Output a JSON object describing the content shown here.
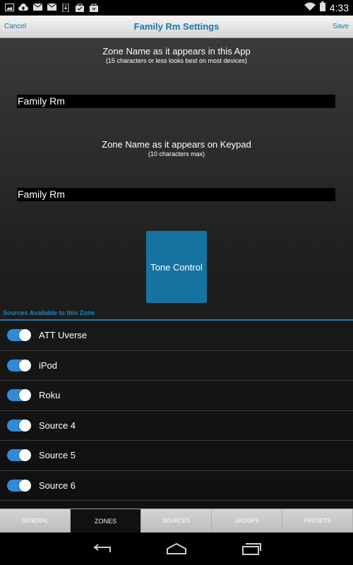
{
  "status_bar": {
    "time": "4:33",
    "left_icons": [
      "image-icon",
      "cloud-upload-icon",
      "mail-icon",
      "mail-icon",
      "download-icon",
      "shopping-bag-icon",
      "shopping-bag-icon"
    ]
  },
  "header": {
    "title": "Family Rm Settings",
    "cancel_label": "Cancel",
    "save_label": "Save"
  },
  "zone_app_name": {
    "caption": "Zone Name as it appears in this App",
    "hint": "(15 characters or less looks best on most devices)",
    "value": "Family Rm"
  },
  "zone_keypad_name": {
    "caption": "Zone Name as it appears on Keypad",
    "hint": "(10 characters max)",
    "value": "Family Rm"
  },
  "tone_control_label": "Tone Control",
  "sources": {
    "section_label": "Sources Available to this Zone",
    "items": [
      {
        "label": "ATT Uverse",
        "enabled": true
      },
      {
        "label": "iPod",
        "enabled": true
      },
      {
        "label": "Roku",
        "enabled": true
      },
      {
        "label": "Source 4",
        "enabled": true
      },
      {
        "label": "Source 5",
        "enabled": true
      },
      {
        "label": "Source 6",
        "enabled": true
      }
    ]
  },
  "tabs": [
    {
      "label": "GENERAL",
      "active": false
    },
    {
      "label": "ZONES",
      "active": true
    },
    {
      "label": "SOURCES",
      "active": false
    },
    {
      "label": "GROUPS",
      "active": false
    },
    {
      "label": "PRESETS",
      "active": false
    }
  ],
  "colors": {
    "accent": "#1779a8",
    "toggle_on": "#2f8bd9",
    "tone_button": "#1673a0"
  }
}
